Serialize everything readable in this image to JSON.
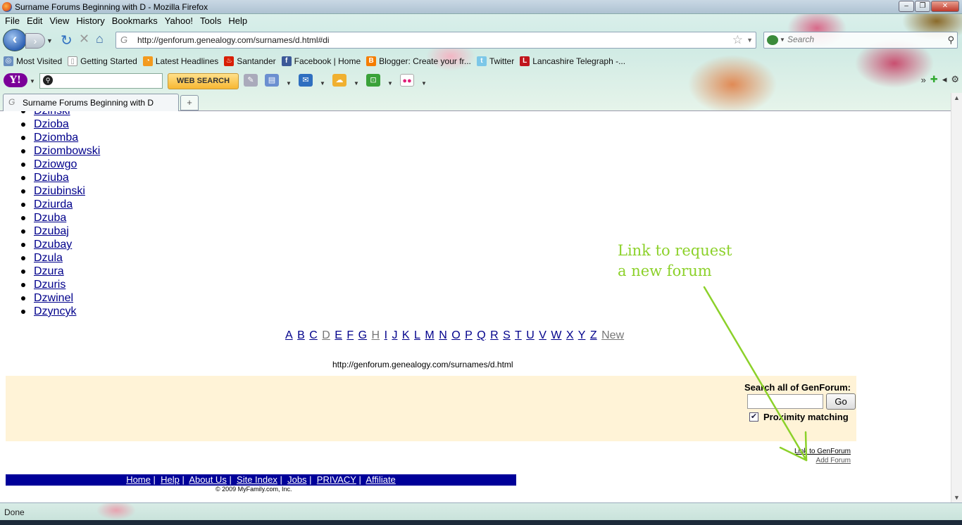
{
  "window": {
    "title": "Surname Forums Beginning with D - Mozilla Firefox"
  },
  "menu": [
    "File",
    "Edit",
    "View",
    "History",
    "Bookmarks",
    "Yahoo!",
    "Tools",
    "Help"
  ],
  "nav": {
    "url": "http://genforum.genealogy.com/surnames/d.html#di",
    "search_placeholder": "Search"
  },
  "bookmarks": [
    "Most Visited",
    "Getting Started",
    "Latest Headlines",
    "Santander",
    "Facebook | Home",
    "Blogger: Create your fr...",
    "Twitter",
    "Lancashire Telegraph -..."
  ],
  "yahoo_toolbar": {
    "web_search_label": "WEB SEARCH"
  },
  "tabs": [
    {
      "title": "Surname Forums Beginning with D",
      "active": true
    }
  ],
  "surnames": [
    "Dzinski",
    "Dzioba",
    "Dziomba",
    "Dziombowski",
    "Dziowgo",
    "Dziuba",
    "Dziubinski",
    "Dziurda",
    "Dzuba",
    "Dzubaj",
    "Dzubay",
    "Dzula",
    "Dzura",
    "Dzuris",
    "Dzwinel",
    "Dzyncyk"
  ],
  "alphabet": [
    "A",
    "B",
    "C",
    "D",
    "E",
    "F",
    "G",
    "H",
    "I",
    "J",
    "K",
    "L",
    "M",
    "N",
    "O",
    "P",
    "Q",
    "R",
    "S",
    "T",
    "U",
    "V",
    "W",
    "X",
    "Y",
    "Z",
    "New"
  ],
  "alphabet_dim": [
    "D",
    "H",
    "New"
  ],
  "page_url_text": "http://genforum.genealogy.com/surnames/d.html",
  "search_panel": {
    "title": "Search all of GenForum:",
    "go_label": "Go",
    "proximity_label": "Proximity matching",
    "proximity_checked": true
  },
  "side_links": {
    "link_to": "Link to GenForum",
    "add_forum": "Add Forum"
  },
  "footer_links": [
    "Home",
    "Help",
    "About Us",
    "Site Index",
    "Jobs",
    "PRIVACY",
    "Affiliate"
  ],
  "copyright": "© 2009 MyFamily.com, Inc.",
  "annotation": {
    "line1": "Link to request",
    "line2": "a new forum",
    "color": "#8cd12a"
  },
  "status": "Done"
}
